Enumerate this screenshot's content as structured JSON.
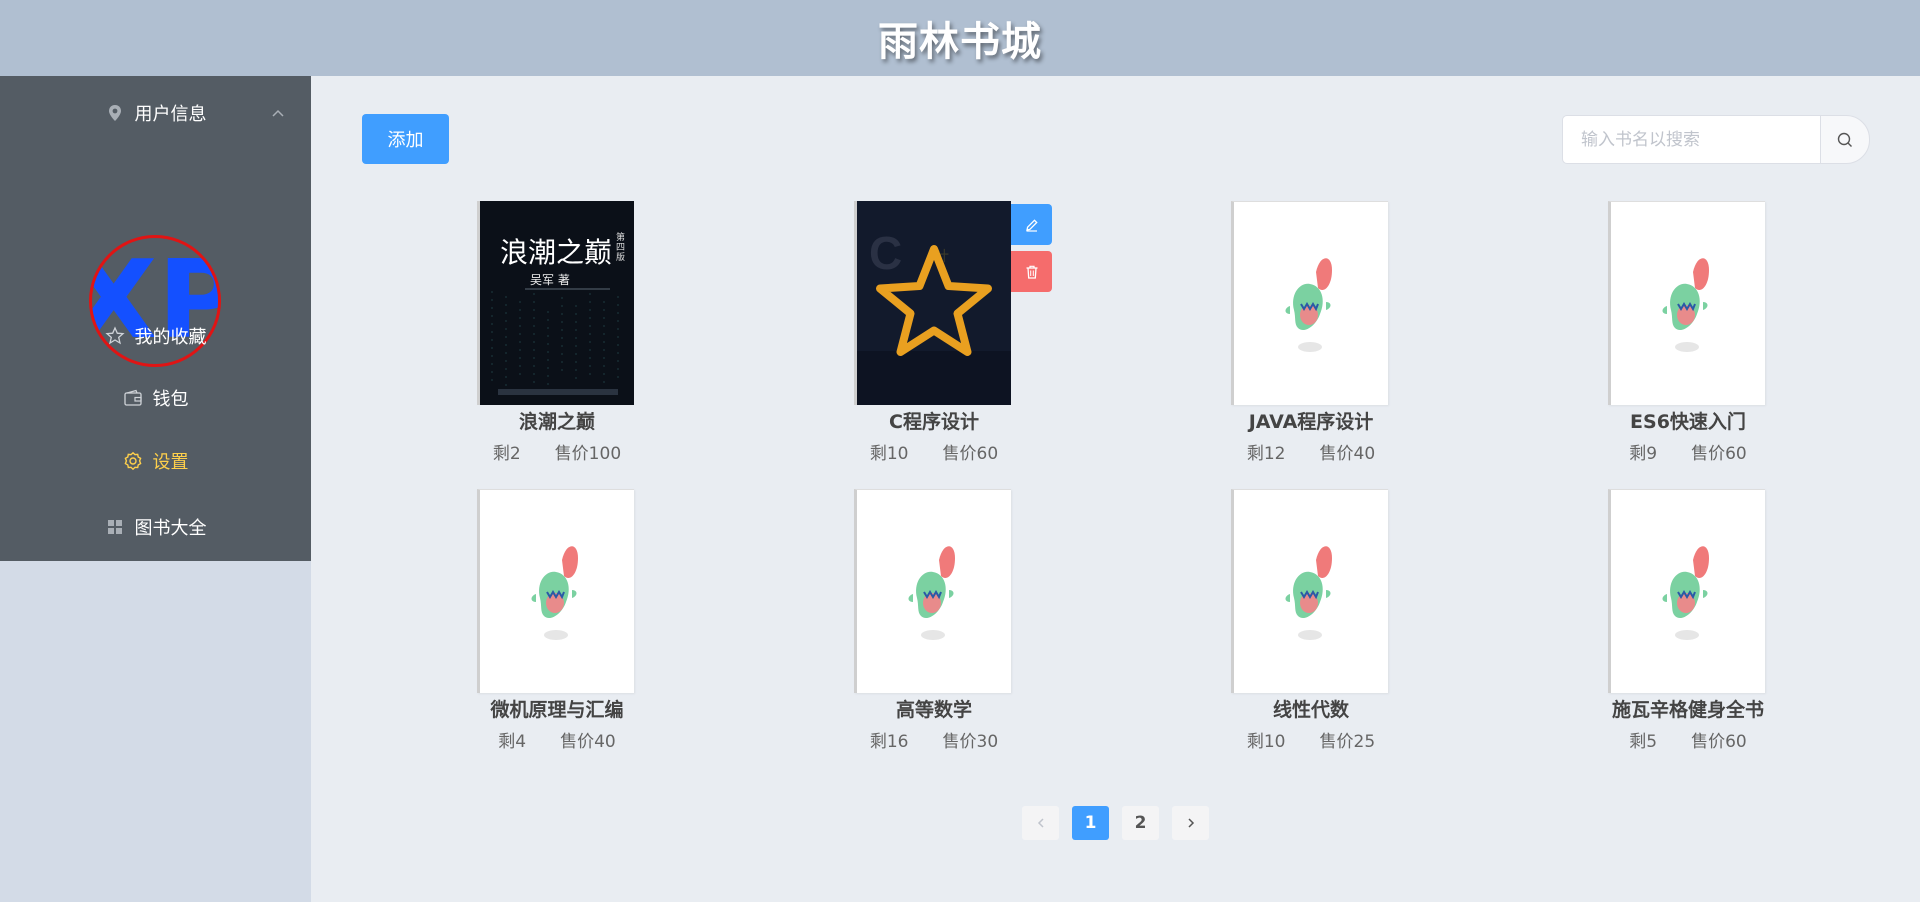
{
  "header": {
    "title": "雨林书城"
  },
  "sidebar": {
    "user_info": "用户信息",
    "avatar_text": "XP",
    "items": [
      {
        "label": "我的收藏",
        "icon": "star-icon"
      },
      {
        "label": "钱包",
        "icon": "wallet-icon"
      },
      {
        "label": "设置",
        "icon": "gear-icon",
        "active": true
      },
      {
        "label": "图书大全",
        "icon": "grid-icon"
      }
    ],
    "active_color": "#ffd04b"
  },
  "toolbar": {
    "add_label": "添加",
    "search_placeholder": "输入书名以搜索"
  },
  "cover_texts": {
    "book1_title": "浪潮之巅",
    "book1_edition": "第四版",
    "book1_author": "吴军 著"
  },
  "books": [
    {
      "title": "浪潮之巅",
      "stock": "剩2",
      "price": "售价100"
    },
    {
      "title": "C程序设计",
      "stock": "剩10",
      "price": "售价60"
    },
    {
      "title": "JAVA程序设计",
      "stock": "剩12",
      "price": "售价40"
    },
    {
      "title": "ES6快速入门",
      "stock": "剩9",
      "price": "售价60"
    },
    {
      "title": "微机原理与汇编",
      "stock": "剩4",
      "price": "售价40"
    },
    {
      "title": "高等数学",
      "stock": "剩16",
      "price": "售价30"
    },
    {
      "title": "线性代数",
      "stock": "剩10",
      "price": "售价25"
    },
    {
      "title": "施瓦辛格健身全书",
      "stock": "剩5",
      "price": "售价60"
    }
  ],
  "pagination": {
    "pages": [
      "1",
      "2"
    ],
    "current": 1
  },
  "colors": {
    "primary": "#409eff",
    "danger": "#f56c6c",
    "star": "#e9a020"
  }
}
